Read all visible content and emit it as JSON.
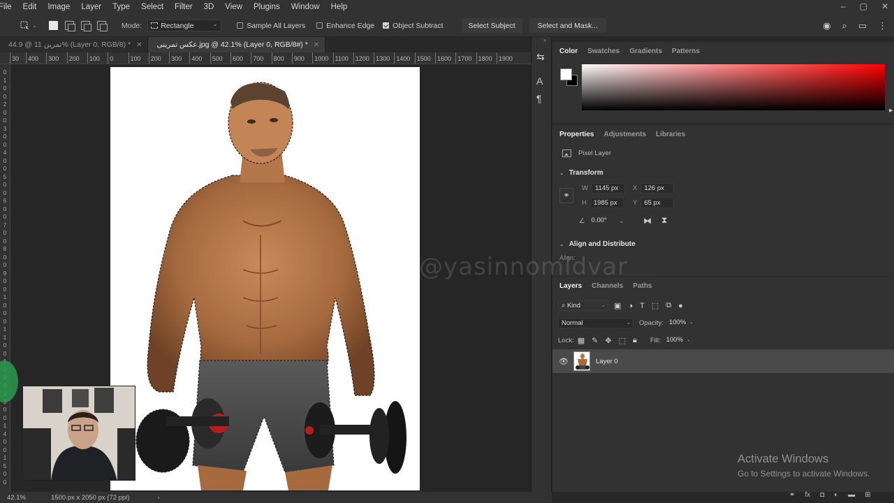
{
  "menu": [
    "File",
    "Edit",
    "Image",
    "Layer",
    "Type",
    "Select",
    "Filter",
    "3D",
    "View",
    "Plugins",
    "Window",
    "Help"
  ],
  "window_controls": {
    "minimize": "–",
    "maximize": "▢",
    "close": "✕"
  },
  "options": {
    "mode_label": "Mode:",
    "mode_value": "Rectangle",
    "sample_all_layers": {
      "label": "Sample All Layers",
      "checked": false
    },
    "enhance_edge": {
      "label": "Enhance Edge",
      "checked": false
    },
    "object_subtract": {
      "label": "Object Subtract",
      "checked": true
    },
    "select_subject": "Select Subject",
    "select_and_mask": "Select and Mask..."
  },
  "tabs": [
    {
      "label": "44.9 @ تمرین 11% (Layer 0, RGB/8) *",
      "active": false
    },
    {
      "label": "عکس تمرینی.jpg @ 42.1% (Layer 0, RGB/8#) *",
      "active": true
    }
  ],
  "ruler_top": [
    "30",
    "400",
    "300",
    "200",
    "100",
    "0",
    "100",
    "200",
    "300",
    "400",
    "500",
    "600",
    "700",
    "800",
    "900",
    "1000",
    "1100",
    "1200",
    "1300",
    "1400",
    "1500",
    "1600",
    "1700",
    "1800",
    "1900"
  ],
  "ruler_left": [
    "0",
    "1",
    "0",
    "0",
    "2",
    "0",
    "0",
    "3",
    "0",
    "0",
    "4",
    "0",
    "0",
    "5",
    "0",
    "0",
    "6",
    "0",
    "0",
    "7",
    "0",
    "0",
    "8",
    "0",
    "0",
    "9",
    "0",
    "0",
    "1",
    "0",
    "0",
    "0",
    "1",
    "1",
    "0",
    "0",
    "1",
    "2",
    "0",
    "0",
    "1",
    "3",
    "0",
    "0",
    "1",
    "4",
    "0",
    "0",
    "1",
    "5",
    "0",
    "0"
  ],
  "watermark": "@yasinnomidvar",
  "status": {
    "zoom": "42.1%",
    "info": "1500 px x 2050 px (72 ppi)",
    "arrow": "›"
  },
  "color_panel": {
    "tabs": [
      "Color",
      "Swatches",
      "Gradients",
      "Patterns"
    ],
    "fg": "#ffffff",
    "bg": "#000000"
  },
  "properties": {
    "tabs": [
      "Properties",
      "Adjustments",
      "Libraries"
    ],
    "layer_type": "Pixel Layer",
    "transform_title": "Transform",
    "w_label": "W",
    "w": "1145 px",
    "h_label": "H",
    "h": "1985 px",
    "x_label": "X",
    "x": "126 px",
    "y_label": "Y",
    "y": "65 px",
    "angle": "0.00°",
    "align_title": "Align and Distribute",
    "align_label": "Align:"
  },
  "layers": {
    "tabs": [
      "Layers",
      "Channels",
      "Paths"
    ],
    "filter_kind": "Kind",
    "blend_mode": "Normal",
    "opacity_label": "Opacity:",
    "opacity": "100%",
    "lock_label": "Lock:",
    "fill_label": "Fill:",
    "fill": "100%",
    "items": [
      {
        "name": "Layer 0",
        "visible": true
      }
    ]
  },
  "activate": {
    "line1": "Activate Windows",
    "line2": "Go to Settings to activate Windows."
  }
}
